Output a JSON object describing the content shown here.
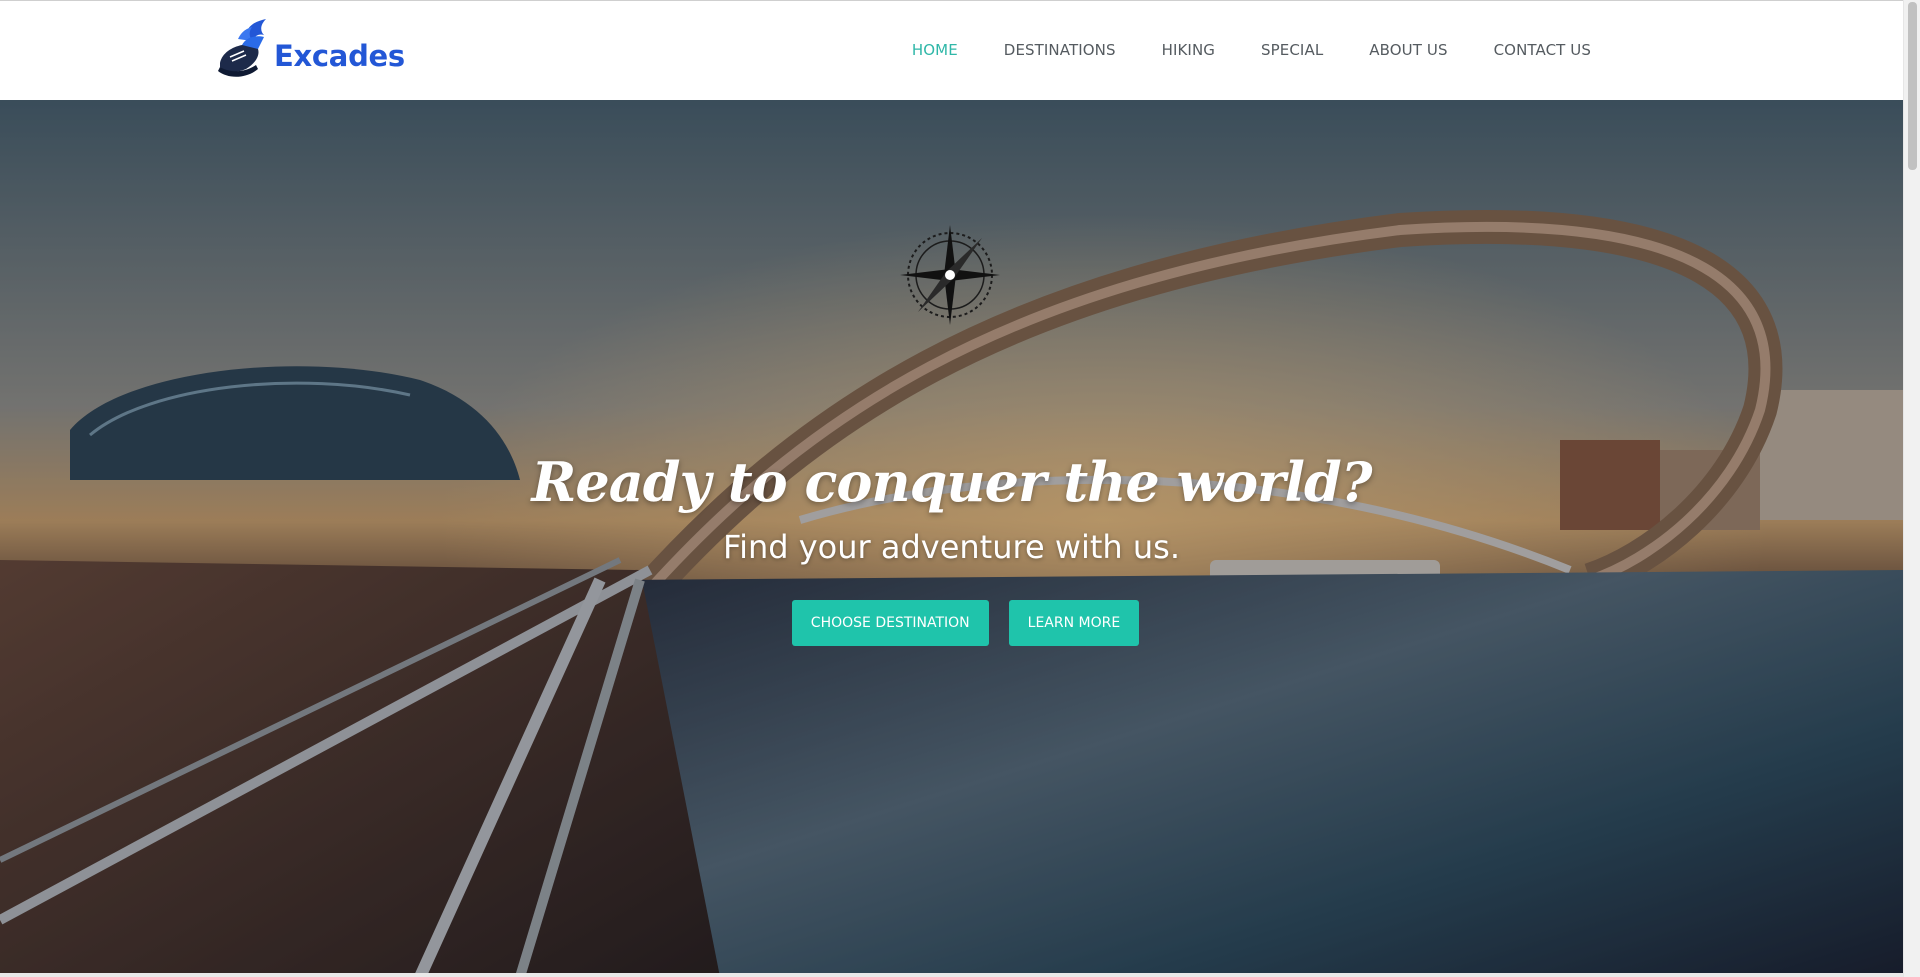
{
  "brand": {
    "name": "Excades",
    "colors": {
      "brand": "#2357d6",
      "accent": "#2fb7a8",
      "button": "#1fc4ab"
    }
  },
  "nav": {
    "items": [
      {
        "label": "HOME",
        "active": true
      },
      {
        "label": "DESTINATIONS",
        "active": false
      },
      {
        "label": "HIKING",
        "active": false
      },
      {
        "label": "SPECIAL",
        "active": false
      },
      {
        "label": "ABOUT US",
        "active": false
      },
      {
        "label": "CONTACT US",
        "active": false
      }
    ]
  },
  "hero": {
    "title": "Ready to conquer the world?",
    "subtitle": "Find your adventure with us.",
    "primary_button": "CHOOSE DESTINATION",
    "secondary_button": "LEARN MORE",
    "icon": "compass-icon"
  }
}
